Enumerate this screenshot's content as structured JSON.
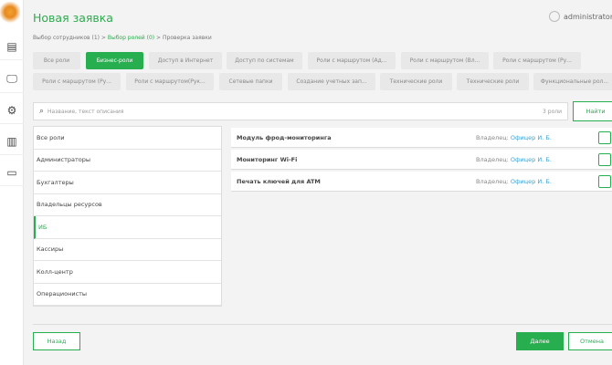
{
  "header": {
    "title": "Новая заявка",
    "user": "administrator"
  },
  "breadcrumb": [
    "Выбор сотрудников (1)",
    "Выбор ролей (0)",
    "Проверка заявки"
  ],
  "breadcrumb_sep": ">",
  "filters": [
    "Все роли",
    "Бизнес-роли",
    "Доступ в Интернет",
    "Доступ по системам",
    "Роли с маршрутом (Ад...",
    "Роли с маршрутом (Вл...",
    "Роли с маршрутом (Ру...",
    "Роли с маршрутом (Ру...",
    "Роли с маршрутом(Рук...",
    "Сетевые папки",
    "Создание учетных зап...",
    "Технические роли",
    "Технические роли",
    "Функциональные рол..."
  ],
  "active_filter": 1,
  "search": {
    "placeholder": "Название, текст описания",
    "count": "3 роли",
    "button": "Найти"
  },
  "categories": [
    "Все роли",
    "Администраторы",
    "Бухгалтеры",
    "Владельцы ресурсов",
    "ИБ",
    "Кассиры",
    "Колл-центр",
    "Операционисты"
  ],
  "selected_category": 4,
  "roles": [
    {
      "name": "Модуль фрод-мониторинга",
      "owner_label": "Владелец:",
      "owner": "Офицер И. Б.",
      "checked": false
    },
    {
      "name": "Мониторинг Wi-Fi",
      "owner_label": "Владелец:",
      "owner": "Офицер И. Б.",
      "checked": false
    },
    {
      "name": "Печать ключей для ATM",
      "owner_label": "Владелец:",
      "owner": "Офицер И. Б.",
      "checked": false
    }
  ],
  "footer": {
    "back": "Назад",
    "next": "Далее",
    "cancel": "Отмена"
  },
  "colors": {
    "accent": "#27ae4f",
    "link": "#3ba3d8"
  }
}
